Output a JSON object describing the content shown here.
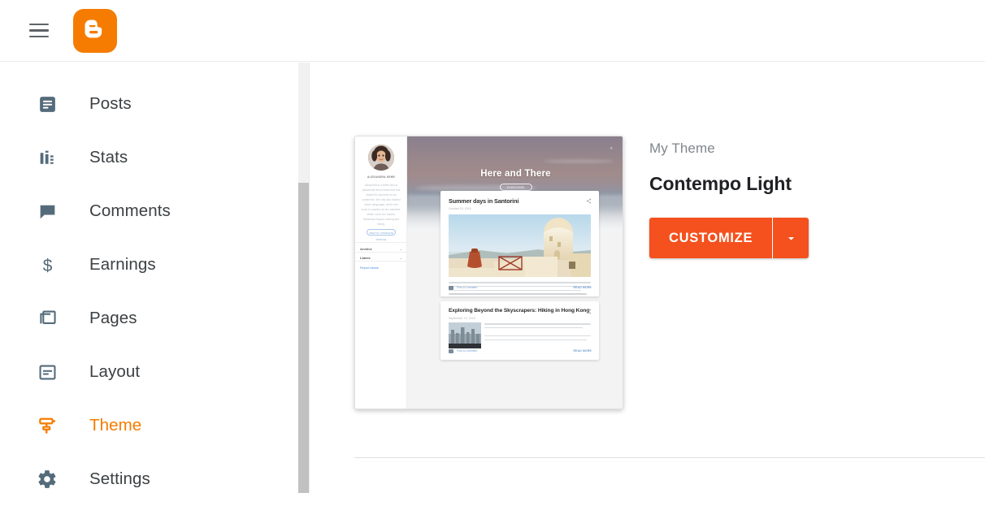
{
  "topbar": {
    "menu_icon": "hamburger-menu-icon",
    "logo_icon": "blogger-logo-icon",
    "logo_color": "#f57c00"
  },
  "sidebar": {
    "items": [
      {
        "id": "posts",
        "label": "Posts",
        "icon": "posts-icon",
        "active": false
      },
      {
        "id": "stats",
        "label": "Stats",
        "icon": "stats-icon",
        "active": false
      },
      {
        "id": "comments",
        "label": "Comments",
        "icon": "comments-icon",
        "active": false
      },
      {
        "id": "earnings",
        "label": "Earnings",
        "icon": "dollar-icon",
        "active": false
      },
      {
        "id": "pages",
        "label": "Pages",
        "icon": "pages-icon",
        "active": false
      },
      {
        "id": "layout",
        "label": "Layout",
        "icon": "layout-icon",
        "active": false
      },
      {
        "id": "theme",
        "label": "Theme",
        "icon": "paint-roller-icon",
        "active": true
      },
      {
        "id": "settings",
        "label": "Settings",
        "icon": "gear-icon",
        "active": false
      }
    ],
    "active_color": "#f57c00",
    "icon_color": "#546b7a",
    "text_color": "#3c4043",
    "scrollbar": {
      "track_color": "#f1f1f1",
      "thumb_color": "#c1c1c1"
    }
  },
  "main": {
    "my_theme_label": "My Theme",
    "theme_name": "Contempo Light",
    "customize_button": "CUSTOMIZE",
    "customize_dropdown_icon": "chevron-down-icon",
    "accent_color": "#f4511e"
  },
  "preview": {
    "blog_title": "Here and There",
    "subscribe_label": "SUBSCRIBE",
    "search_icon": "search-icon",
    "profile": {
      "name": "ALEXANDRA KEHR",
      "bio": "Alexandra is a writer who is passionate about travel and has visited 54 countries on six continents. She has also studied seven languages, which she loves to practice as she wanders. When not in her travels, Alexandra enjoys cooking and hiking.",
      "follow_label": "VIEW MY COMPLETE PROFILE"
    },
    "widgets": [
      {
        "label": "Archive",
        "icon": "chevron-down-icon"
      },
      {
        "label": "Labels",
        "icon": "chevron-down-icon"
      }
    ],
    "report_abuse": "Report Abuse",
    "posts": [
      {
        "title": "Summer days in Santorini",
        "date": "October 19, 2015",
        "share_icon": "share-icon",
        "comment_label": "Post a Comment",
        "read_more": "READ MORE",
        "image": "santorini-windmill-photo"
      },
      {
        "title": "Exploring Beyond the Skyscrapers: Hiking in Hong Kong",
        "date": "September 13, 2015",
        "share_icon": "share-icon",
        "comment_label": "Post a Comment",
        "read_more": "READ MORE",
        "image": "hong-kong-skyline-photo"
      }
    ]
  }
}
